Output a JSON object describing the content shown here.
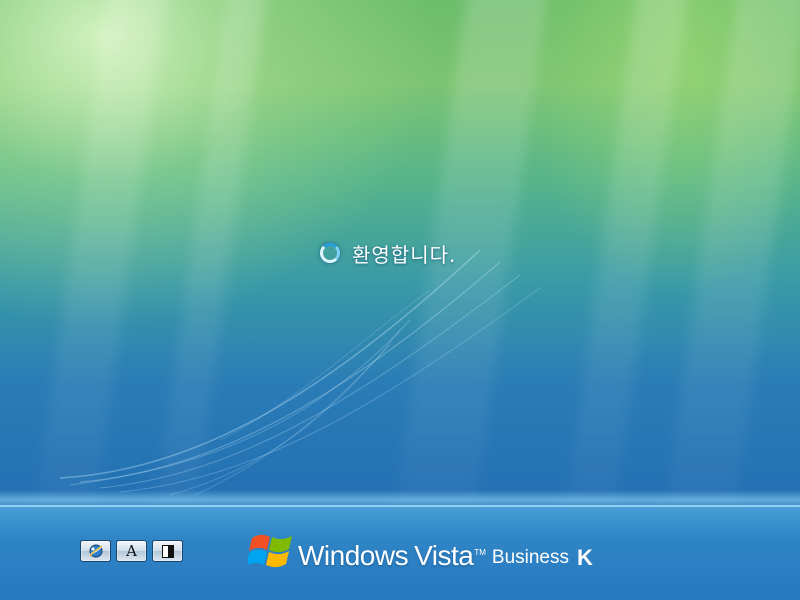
{
  "welcome": {
    "status_icon": "spinner-icon",
    "message": "환영합니다."
  },
  "ease_of_access": {
    "buttons": [
      {
        "icon": "ease-of-access-icon",
        "label": ""
      },
      {
        "icon": "large-text-icon",
        "label": "A"
      },
      {
        "icon": "high-contrast-icon",
        "label": ""
      }
    ]
  },
  "branding": {
    "logo_icon": "windows-flag-icon",
    "name": "Windows",
    "product": "Vista",
    "trademark": "TM",
    "edition": "Business",
    "suffix": "K"
  },
  "colors": {
    "background_top": "#7cc472",
    "background_bottom": "#2472b4",
    "text": "#ffffff"
  }
}
